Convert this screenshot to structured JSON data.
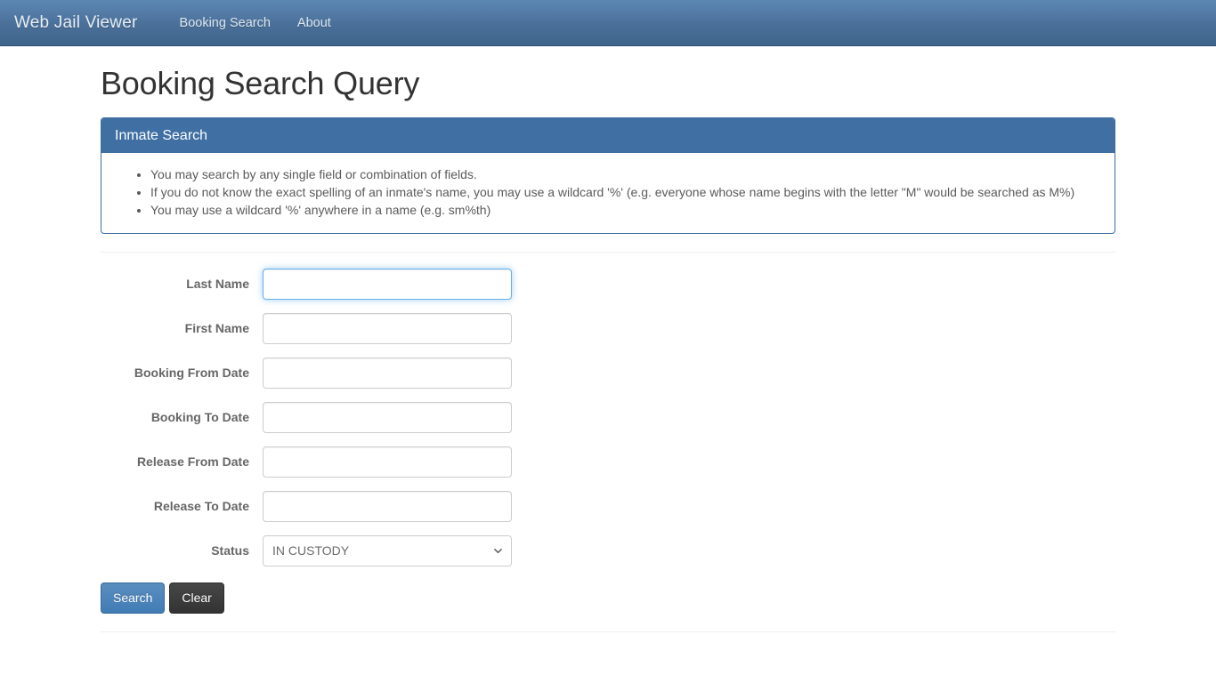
{
  "navbar": {
    "brand": "Web Jail Viewer",
    "links": [
      {
        "label": "Booking Search"
      },
      {
        "label": "About"
      }
    ]
  },
  "page": {
    "title": "Booking Search Query"
  },
  "panel": {
    "heading": "Inmate Search",
    "tips": [
      "You may search by any single field or combination of fields.",
      "If you do not know the exact spelling of an inmate's name, you may use a wildcard '%' (e.g. everyone whose name begins with the letter \"M\" would be searched as M%)",
      "You may use a wildcard '%' anywhere in a name (e.g. sm%th)"
    ]
  },
  "form": {
    "fields": [
      {
        "label": "Last Name",
        "value": "",
        "placeholder": "",
        "focused": true
      },
      {
        "label": "First Name",
        "value": "",
        "placeholder": "",
        "focused": false
      },
      {
        "label": "Booking From Date",
        "value": "",
        "placeholder": "",
        "focused": false
      },
      {
        "label": "Booking To Date",
        "value": "",
        "placeholder": "",
        "focused": false
      },
      {
        "label": "Release From Date",
        "value": "",
        "placeholder": "",
        "focused": false
      },
      {
        "label": "Release To Date",
        "value": "",
        "placeholder": "",
        "focused": false
      }
    ],
    "status": {
      "label": "Status",
      "selected": "IN CUSTODY",
      "options": [
        "IN CUSTODY"
      ]
    },
    "buttons": {
      "search": "Search",
      "clear": "Clear"
    }
  },
  "colors": {
    "navbar_top": "#5d87b4",
    "navbar_bottom": "#3f648c",
    "panel_heading": "#3f6fa3",
    "panel_border": "#3d6ca0",
    "primary_button": "#417cb5",
    "clear_button": "#333333",
    "focus_ring": "#66afe9"
  }
}
